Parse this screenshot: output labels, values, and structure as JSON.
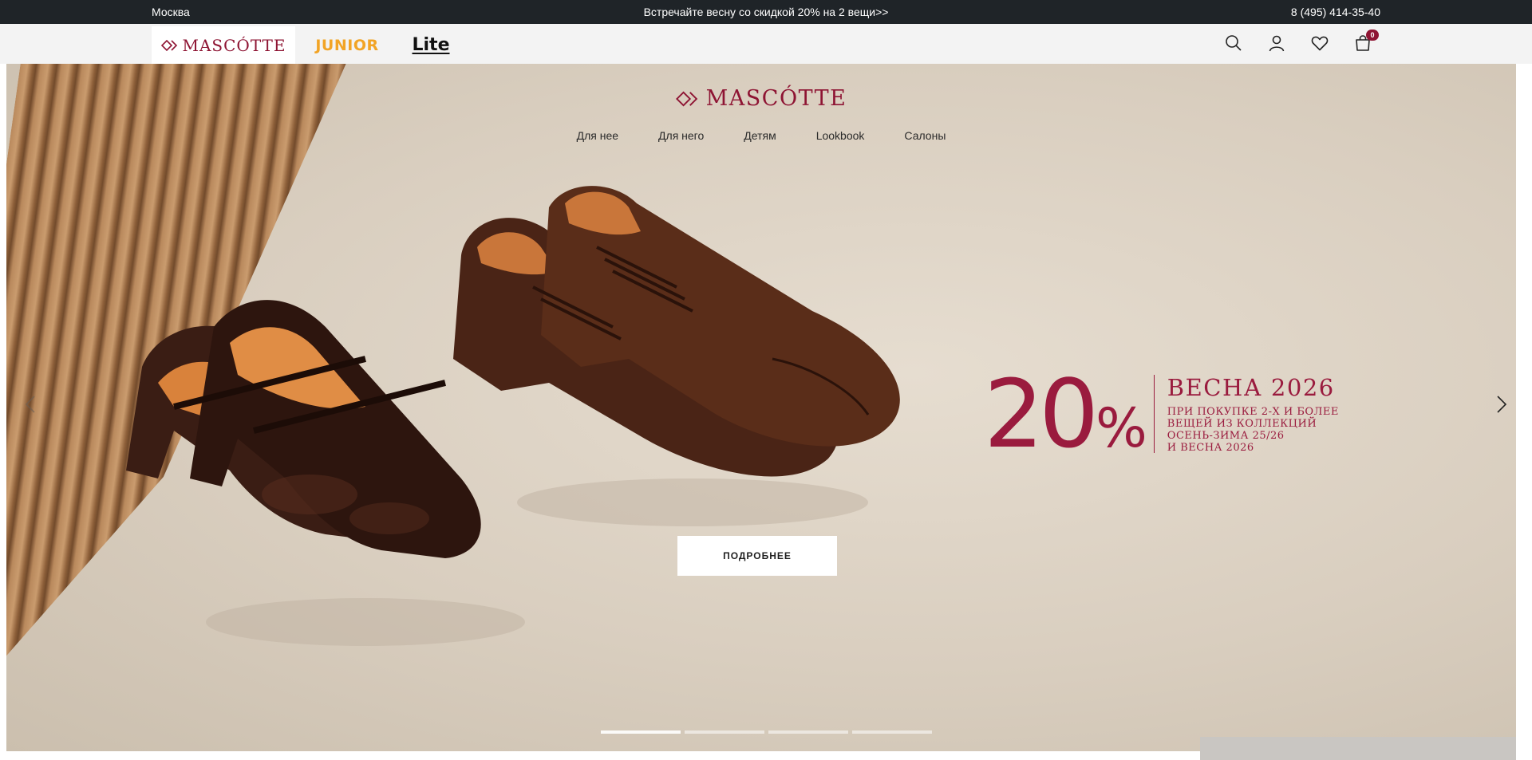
{
  "topbar": {
    "city": "Москва",
    "promo": "Встречайте весну со скидкой 20% на 2 вещи>>",
    "phone": "8 (495) 414-35-40"
  },
  "header": {
    "brands": [
      {
        "label": "MASCÓTTE",
        "active": true
      },
      {
        "label": "JUNIOR",
        "active": false
      },
      {
        "label": "Lite",
        "active": false
      }
    ],
    "icons": [
      "search-icon",
      "account-icon",
      "heart-icon",
      "cart-icon"
    ],
    "cart_count": "0"
  },
  "hero": {
    "logo": "MASCÓTTE",
    "nav": [
      "Для нее",
      "Для него",
      "Детям",
      "Lookbook",
      "Салоны"
    ],
    "promo": {
      "big": "20",
      "percent": "%",
      "title": "ВЕСНА 2026",
      "lines": [
        "ПРИ ПОКУПКЕ 2-Х И БОЛЕЕ",
        "ВЕЩЕЙ ИЗ КОЛЛЕКЦИЙ",
        "ОСЕНЬ-ЗИМА 25/26",
        "И ВЕСНА 2026"
      ]
    },
    "button": "ПОДРОБНЕЕ",
    "slides_total": 4,
    "slide_active": 1
  },
  "colors": {
    "brand": "#8e1433",
    "junior": "#f2a425",
    "topbar_bg": "#1f2428"
  }
}
